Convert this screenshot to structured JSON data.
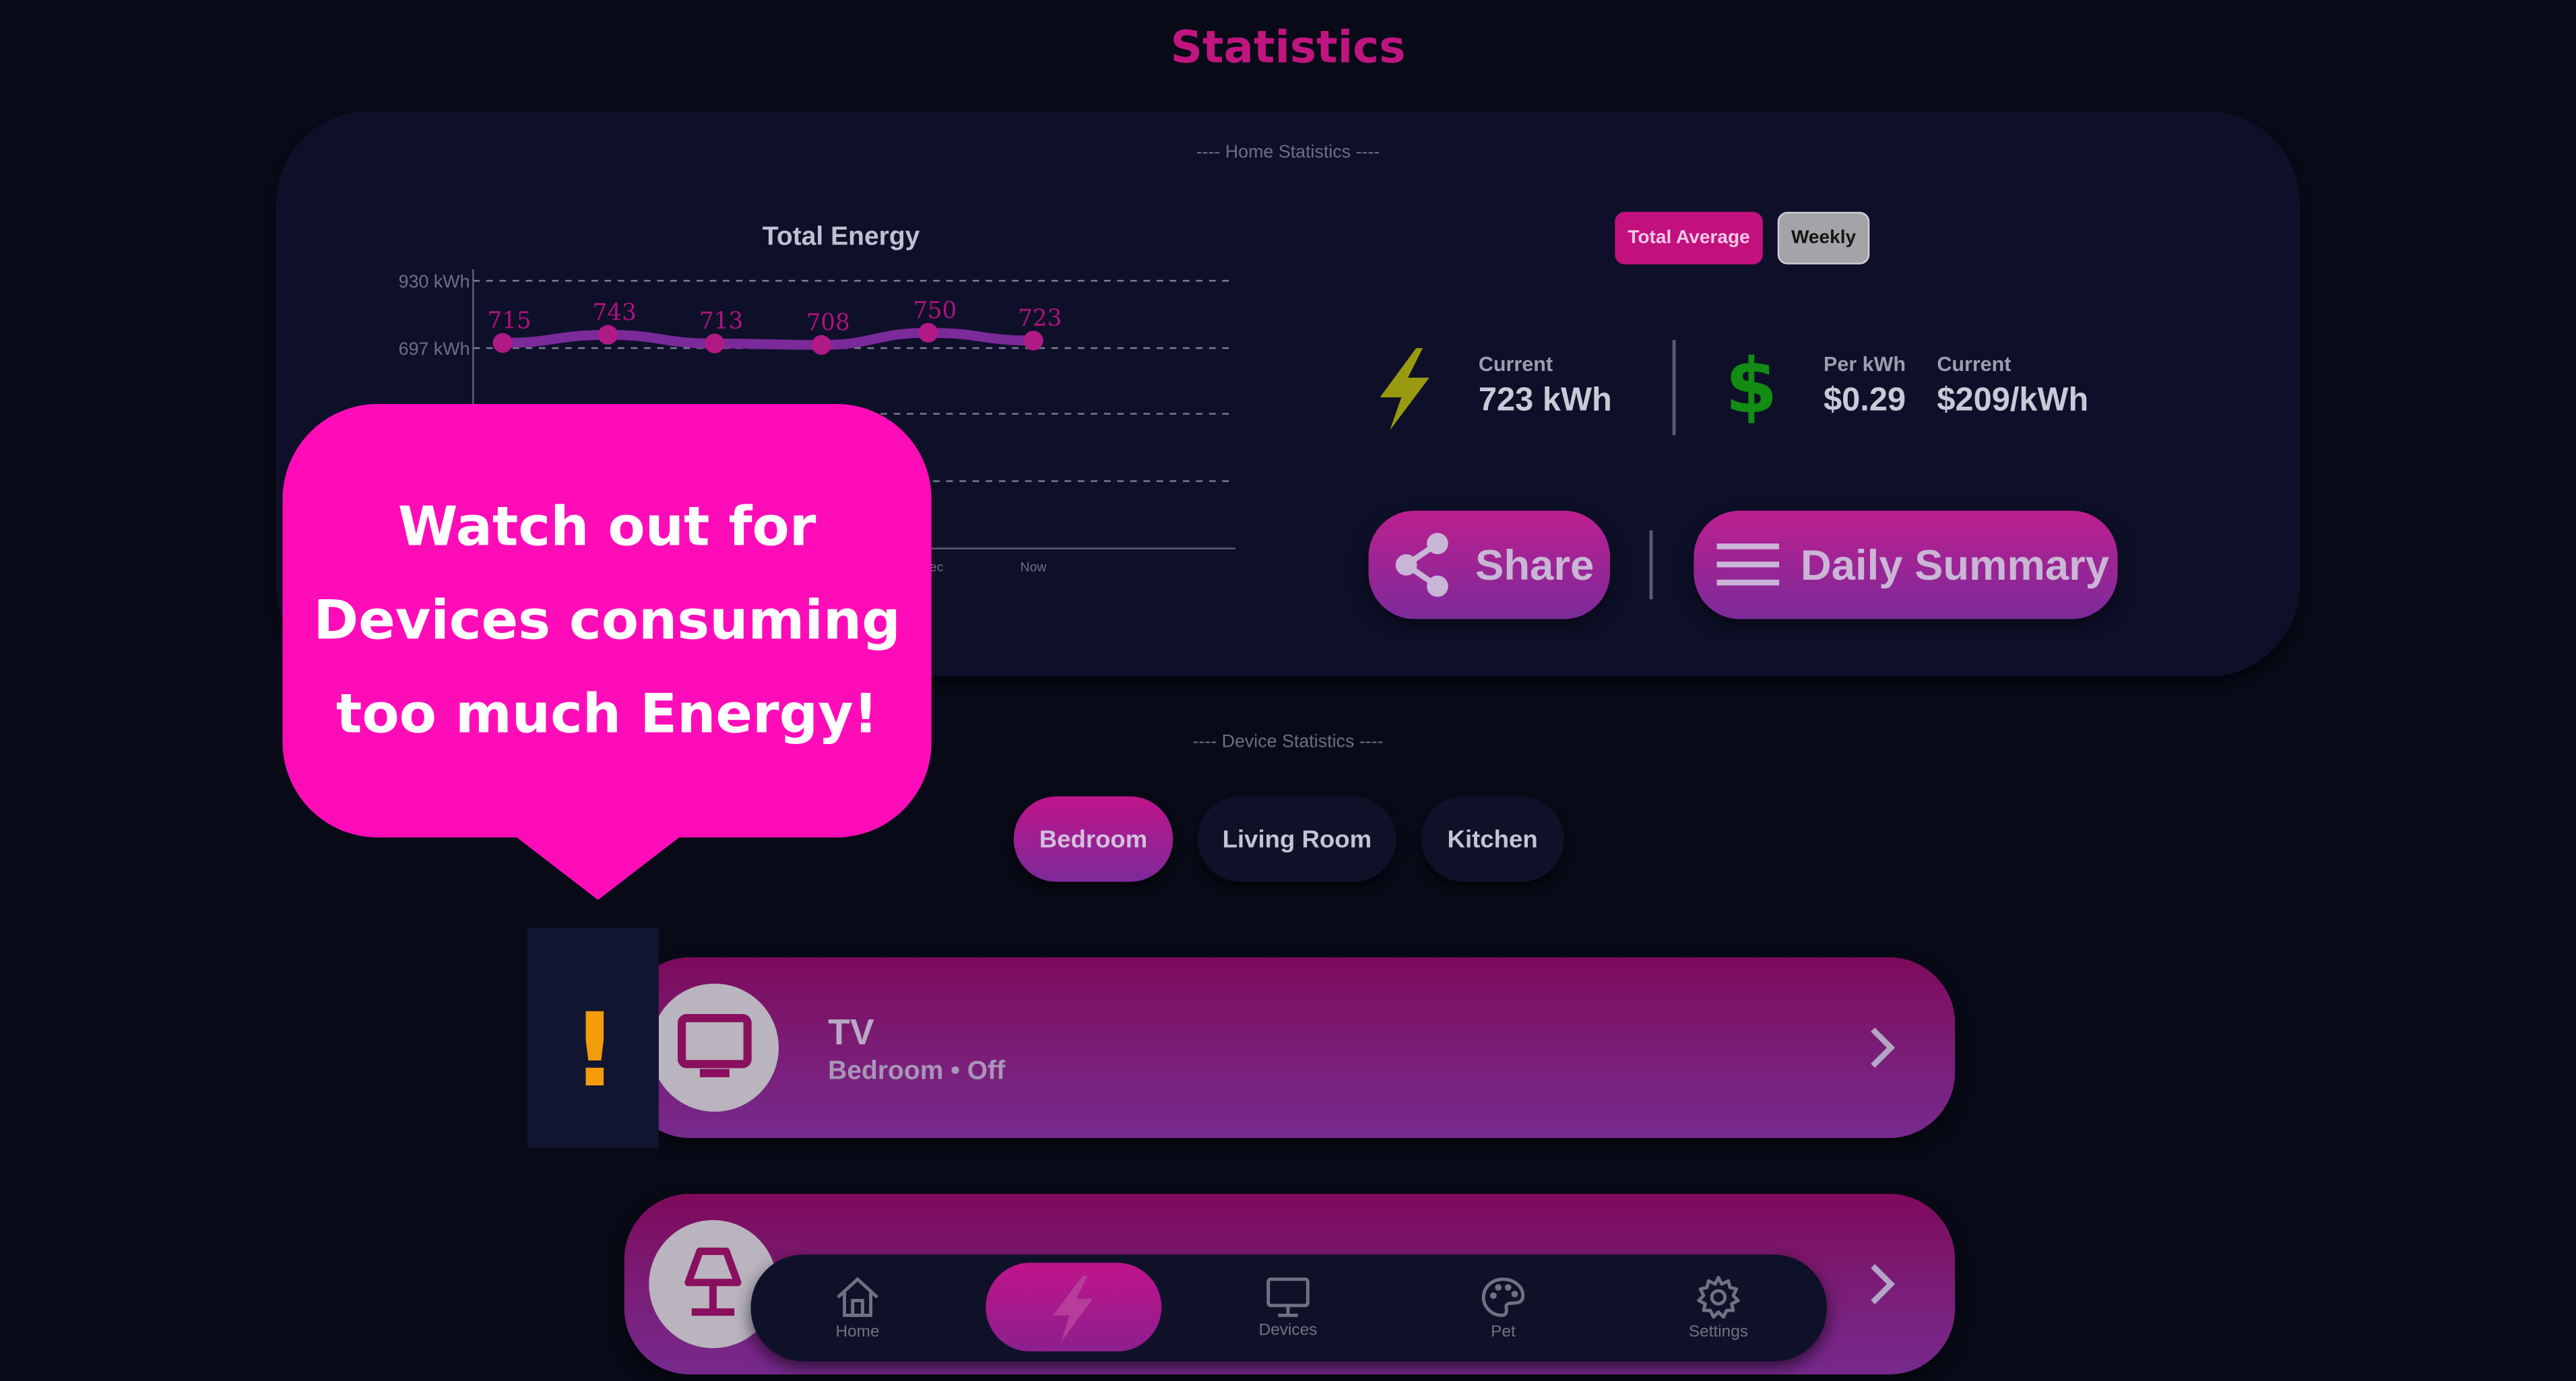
{
  "page_title": "Statistics",
  "home_section_label": "---- Home Statistics ----",
  "device_section_label": "---- Device Statistics ----",
  "chart": {
    "title": "Total Energy",
    "y_ticks": [
      "930 kWh",
      "697 kWh"
    ],
    "x_ticks_visible": [
      "ec",
      "Now"
    ]
  },
  "chart_data": {
    "type": "line",
    "title": "Total Energy",
    "y_tick_labels": [
      "930 kWh",
      "697 kWh"
    ],
    "x_tick_labels": [
      "ec",
      "Now"
    ],
    "values": [
      715,
      743,
      713,
      708,
      750,
      723
    ],
    "ylim": [
      0,
      930
    ],
    "grid": true,
    "line_color": "#7b2a9a",
    "point_color": "#b01a85",
    "label_color": "#b0127f"
  },
  "toggles": {
    "total_average": "Total Average",
    "weekly": "Weekly"
  },
  "energy": {
    "current_label": "Current",
    "current_value": "723 kWh",
    "icon": "lightning-bolt-icon",
    "icon_color": "#9a9a10"
  },
  "cost": {
    "icon": "dollar-icon",
    "icon_color": "#128c12",
    "per_kwh_label": "Per kWh",
    "per_kwh_value": "$0.29",
    "current_label": "Current",
    "current_value": "$209/kWh"
  },
  "actions": {
    "share": "Share",
    "daily_summary": "Daily Summary"
  },
  "rooms": [
    "Bedroom",
    "Living Room",
    "Kitchen"
  ],
  "devices": [
    {
      "name": "TV",
      "room": "Bedroom",
      "status": "Off",
      "subtitle": "Bedroom • Off",
      "icon": "tv-icon"
    },
    {
      "icon": "lamp-icon"
    }
  ],
  "tooltip": {
    "lines": [
      "Watch out for",
      "Devices consuming",
      "too much Energy!"
    ]
  },
  "warning": "!",
  "nav": {
    "home": "Home",
    "energy_icon": "lightning-bolt-icon",
    "devices": "Devices",
    "pet": "Pet",
    "settings": "Settings"
  },
  "colors": {
    "accent": "#c0157f",
    "background": "#080a17",
    "panel": "#0e1029",
    "tooltip": "#ff0cb9",
    "warning": "#f39c0b"
  }
}
